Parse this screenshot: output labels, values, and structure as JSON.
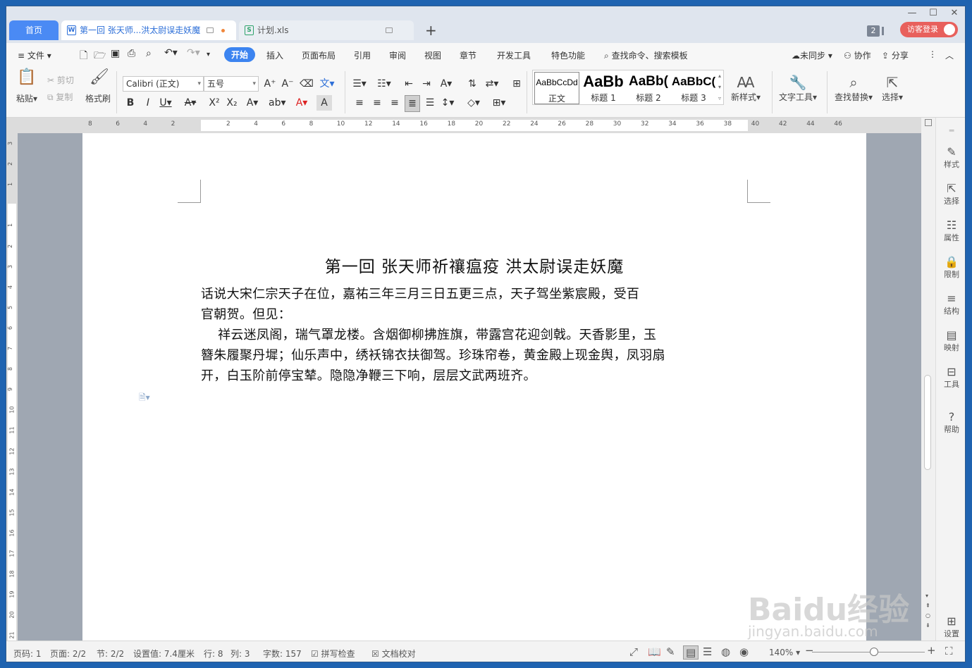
{
  "tabs": {
    "home": "首页",
    "doc": "第一回 张天师...洪太尉误走妖魔",
    "xls": "计划.xls",
    "new": "+"
  },
  "titlebar": {
    "count_badge": "2",
    "login": "访客登录",
    "minimize": "—",
    "maximize": "☐",
    "close": "✕"
  },
  "menu": {
    "file": "文件",
    "items": [
      "开始",
      "插入",
      "页面布局",
      "引用",
      "审阅",
      "视图",
      "章节",
      "开发工具",
      "特色功能"
    ],
    "search": "查找命令、搜索模板",
    "sync": "未同步",
    "collab": "协作",
    "share": "分享"
  },
  "ribbon": {
    "paste": "粘贴",
    "cut": "剪切",
    "copy": "复制",
    "format_painter": "格式刷",
    "font_name": "Calibri (正文)",
    "font_size": "五号",
    "styles": [
      {
        "preview": "AaBbCcDd",
        "name": "正文"
      },
      {
        "preview": "AaBb",
        "name": "标题 1"
      },
      {
        "preview": "AaBb(",
        "name": "标题 2"
      },
      {
        "preview": "AaBbC(",
        "name": "标题 3"
      }
    ],
    "new_style": "新样式",
    "text_tools": "文字工具",
    "find_replace": "查找替换",
    "select": "选择"
  },
  "ruler": {
    "h_ticks": [
      "8",
      "6",
      "4",
      "2",
      "",
      "2",
      "4",
      "6",
      "8",
      "10",
      "12",
      "14",
      "16",
      "18",
      "20",
      "22",
      "24",
      "26",
      "28",
      "30",
      "32",
      "34",
      "36",
      "38",
      "40",
      "42",
      "44",
      "46"
    ],
    "v_ticks": [
      "3",
      "2",
      "1",
      "",
      "1",
      "2",
      "3",
      "4",
      "5",
      "6",
      "7",
      "8",
      "9",
      "10",
      "11",
      "12",
      "13",
      "14",
      "15",
      "16",
      "17",
      "18",
      "19",
      "20",
      "21"
    ]
  },
  "document": {
    "title": "第一回  张天师祈禳瘟疫    洪太尉误走妖魔",
    "lines": [
      "话说大宋仁宗天子在位，嘉祐三年三月三日五更三点，天子驾坐紫宸殿，受百",
      "官朝贺。但见：",
      "    祥云迷凤阁，瑞气罩龙楼。含烟御柳拂旌旗，带露宫花迎剑戟。天香影里，玉",
      "簪朱履聚丹墀；仙乐声中，绣袄锦衣扶御驾。珍珠帘卷，黄金殿上现金舆，凤羽扇",
      "开，白玉阶前停宝辇。隐隐净鞭三下响，层层文武两班齐。"
    ]
  },
  "right_pane": [
    "样式",
    "选择",
    "属性",
    "限制",
    "结构",
    "映射",
    "工具",
    "帮助",
    "设置"
  ],
  "status": {
    "page_num": "页码: 1",
    "pages": "页面: 2/2",
    "section": "节: 2/2",
    "setting": "设置值: 7.4厘米",
    "row": "行: 8",
    "col": "列: 3",
    "words": "字数: 157",
    "spell": "拼写检查",
    "proof": "文档校对",
    "zoom": "140%"
  },
  "watermark": {
    "main": "Baidu经验",
    "sub": "jingyan.baidu.com"
  },
  "colors": {
    "accent": "#3c84f0",
    "login": "#e8605c",
    "tab_active_text": "#2d6fd8"
  }
}
